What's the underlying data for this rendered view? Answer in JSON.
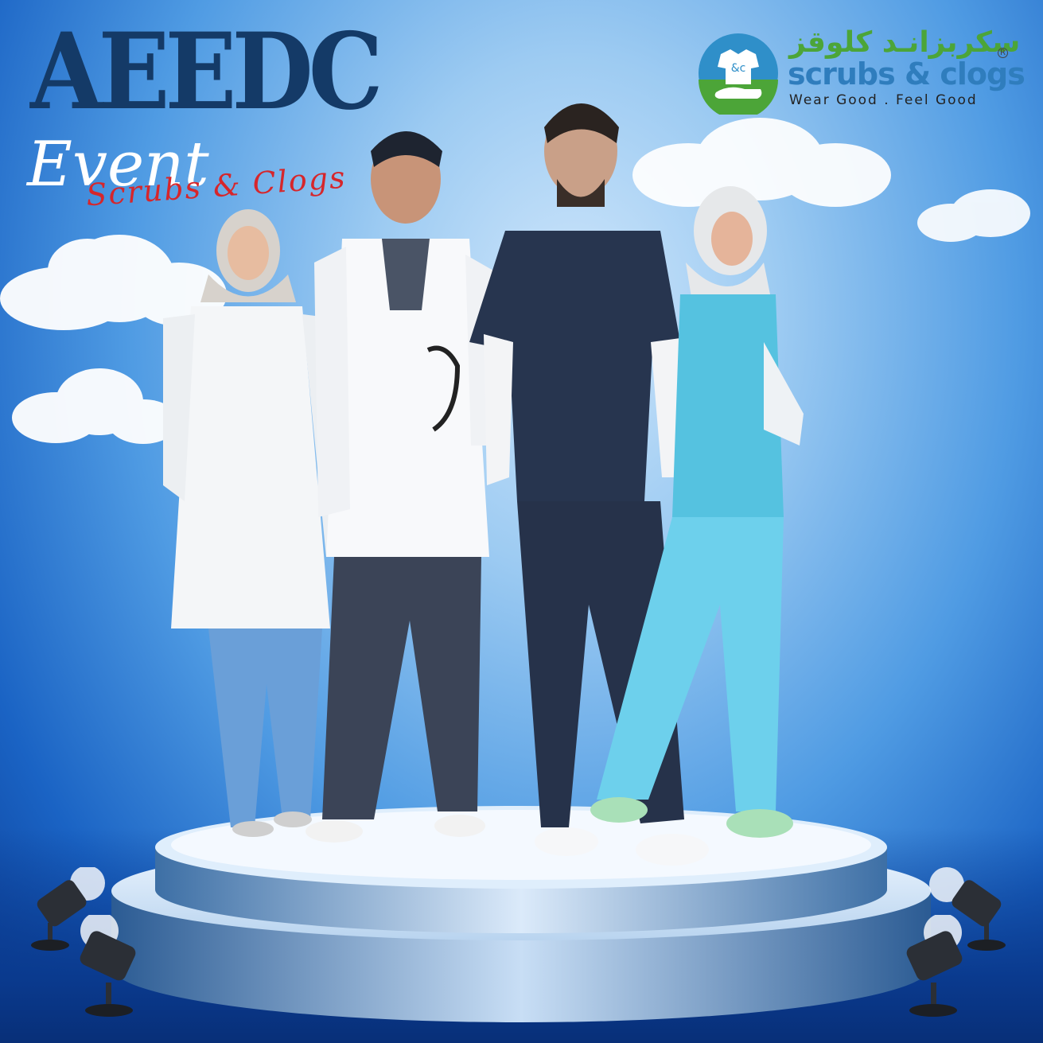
{
  "poster": {
    "title": "AEEDC",
    "subtitle": "Event",
    "script_text": "Scrubs & Clogs"
  },
  "logo": {
    "arabic_name": "سكربزانـد كلوقز",
    "name": "scrubs & clogs",
    "registered_mark": "R",
    "tagline": "Wear Good . Feel Good",
    "colors": {
      "blue": "#2f7dbd",
      "green": "#4ca538"
    }
  },
  "colors": {
    "title_navy": "#143a67",
    "sky_light": "#cfe6fb",
    "sky_deep": "#0c3f97",
    "script_red": "#d6262b"
  },
  "figures": [
    {
      "name": "woman-white-coat",
      "outfit": "white lab coat, light blue scrub pants, grey hijab"
    },
    {
      "name": "man-white-coat",
      "outfit": "white lab coat, charcoal scrubs, stethoscope"
    },
    {
      "name": "man-navy-scrubs",
      "outfit": "navy scrub top and pants, white sneakers"
    },
    {
      "name": "woman-aqua-scrubs",
      "outfit": "aqua scrubs, white hijab, green sneakers"
    }
  ]
}
